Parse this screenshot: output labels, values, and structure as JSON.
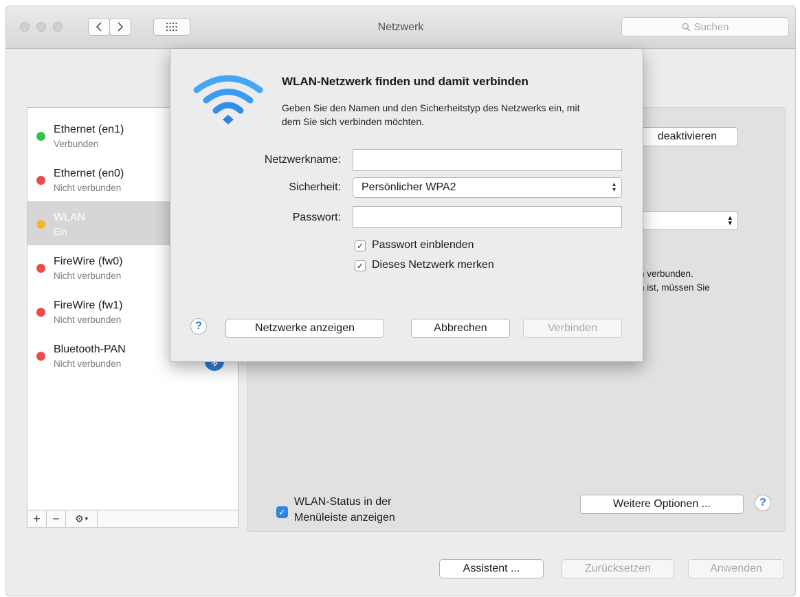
{
  "window": {
    "title": "Netzwerk"
  },
  "toolbar": {
    "search_placeholder": "Suchen"
  },
  "services": [
    {
      "name": "Ethernet (en1)",
      "status": "Verbunden",
      "color": "#34c24a"
    },
    {
      "name": "Ethernet (en0)",
      "status": "Nicht verbunden",
      "color": "#ee4a48"
    },
    {
      "name": "WLAN",
      "status": "Ein",
      "color": "#f4b42c"
    },
    {
      "name": "FireWire (fw0)",
      "status": "Nicht verbunden",
      "color": "#ee4a48"
    },
    {
      "name": "FireWire (fw1)",
      "status": "Nicht verbunden",
      "color": "#ee4a48"
    },
    {
      "name": "Bluetooth-PAN",
      "status": "Nicht verbunden",
      "color": "#ee4a48"
    }
  ],
  "list_tools": {
    "add": "+",
    "remove": "−"
  },
  "detail": {
    "deactivate_label": "deaktivieren",
    "status_line_1": "h verbunden.",
    "status_line_2": "n ist, müssen Sie",
    "menubar_checkbox_label": "WLAN-Status in der Menüleiste anzeigen",
    "advanced_label": "Weitere Optionen ..."
  },
  "dialog": {
    "title": "WLAN-Netzwerk finden und damit verbinden",
    "description": "Geben Sie den Namen und den Sicherheitstyp des Netzwerks ein, mit dem Sie sich verbinden möchten.",
    "network_name_label": "Netzwerkname:",
    "network_name_value": "",
    "security_label": "Sicherheit:",
    "security_value": "Persönlicher WPA2",
    "password_label": "Passwort:",
    "password_value": "",
    "show_password_label": "Passwort einblenden",
    "remember_label": "Dieses Netzwerk merken",
    "show_networks_label": "Netzwerke anzeigen",
    "cancel_label": "Abbrechen",
    "connect_label": "Verbinden"
  },
  "footer": {
    "assistant_label": "Assistent ...",
    "revert_label": "Zurücksetzen",
    "apply_label": "Anwenden"
  },
  "help_glyph": "?",
  "colors": {
    "accent": "#2f86e0",
    "wifi": "#3a9bf0"
  }
}
